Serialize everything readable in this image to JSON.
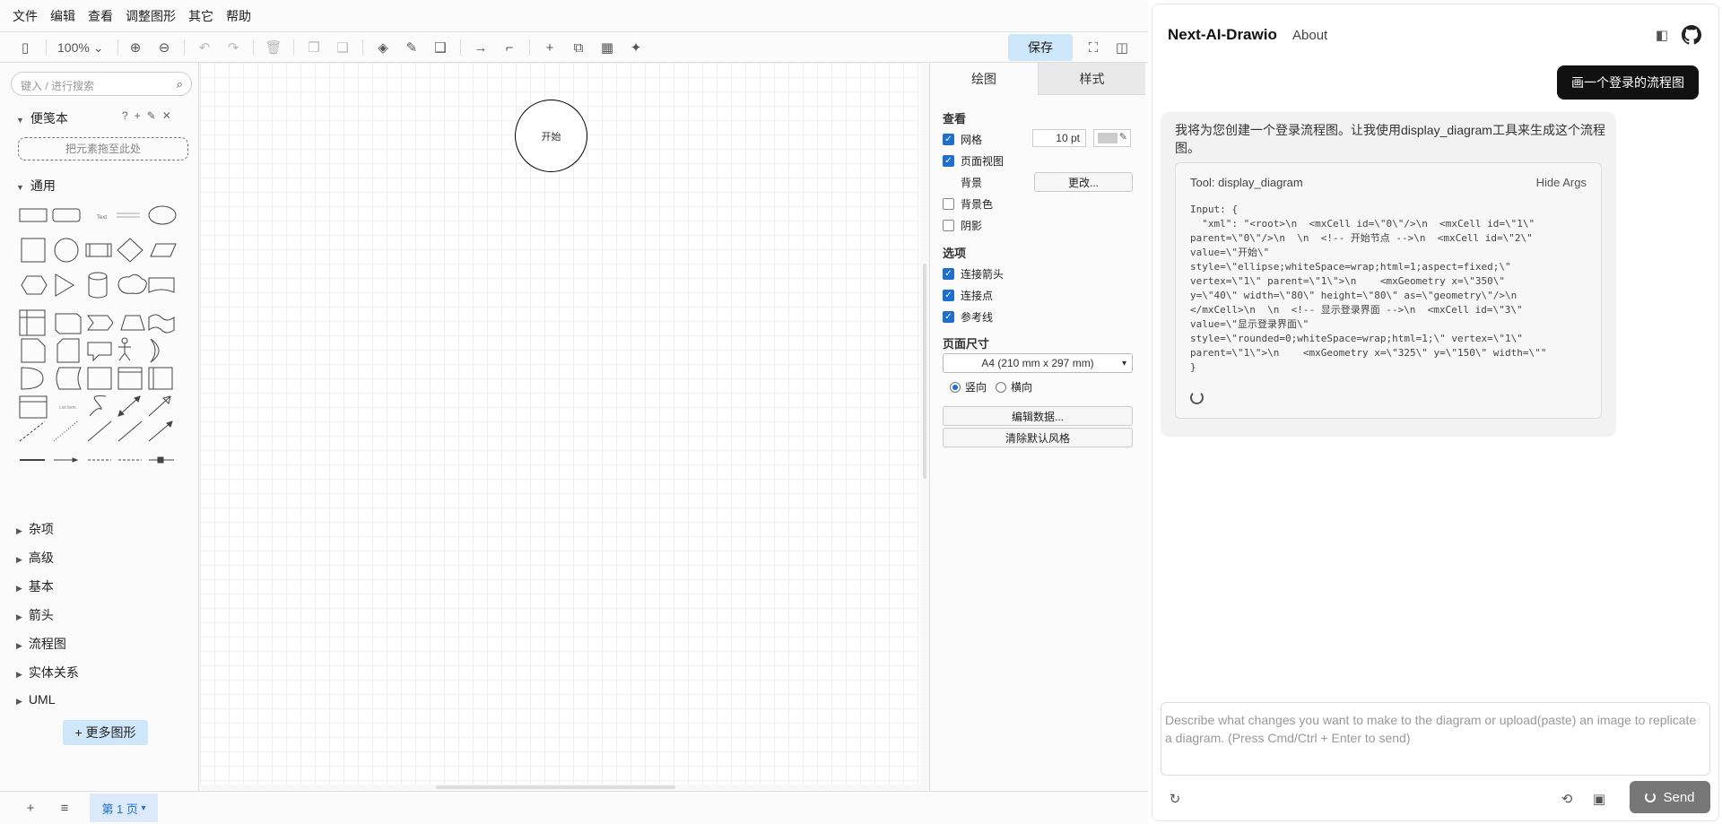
{
  "menu": [
    "文件",
    "编辑",
    "查看",
    "调整图形",
    "其它",
    "帮助"
  ],
  "toolbar": {
    "zoom": "100%",
    "save_label": "保存"
  },
  "sidebar": {
    "search_placeholder": "键入 / 进行搜索",
    "scratchpad_label": "便笺本",
    "scratchpad_drop": "把元素拖至此处",
    "general_label": "通用",
    "categories": [
      "杂项",
      "高级",
      "基本",
      "箭头",
      "流程图",
      "实体关系",
      "UML"
    ],
    "more_shapes": "+ 更多图形"
  },
  "canvas": {
    "start_node_label": "开始"
  },
  "format_panel": {
    "tabs": [
      "绘图",
      "样式"
    ],
    "view_title": "查看",
    "grid_label": "网格",
    "grid_size": "10 pt",
    "page_view_label": "页面视图",
    "background_label": "背景",
    "change_btn": "更改...",
    "background_color_label": "背景色",
    "shadow_label": "阴影",
    "options_title": "选项",
    "connection_arrows_label": "连接箭头",
    "connection_points_label": "连接点",
    "guides_label": "参考线",
    "page_size_title": "页面尺寸",
    "page_size_value": "A4 (210 mm x 297 mm)",
    "portrait_label": "竖向",
    "landscape_label": "横向",
    "edit_data_btn": "编辑数据...",
    "clear_style_btn": "清除默认风格",
    "checks": {
      "grid": true,
      "page_view": true,
      "background_color": false,
      "shadow": false,
      "connection_arrows": true,
      "connection_points": true,
      "guides": true
    }
  },
  "bottom": {
    "page_tab": "第 1 页"
  },
  "chat": {
    "title": "Next-AI-Drawio",
    "about": "About",
    "user_message": "画一个登录的流程图",
    "bot_text": "我将为您创建一个登录流程图。让我使用display_diagram工具来生成这个流程图。",
    "tool_name": "Tool: display_diagram",
    "hide_args": "Hide Args",
    "tool_code": "Input: {\n  \"xml\": \"<root>\\n  <mxCell id=\\\"0\\\"/>\\n  <mxCell id=\\\"1\\\"\nparent=\\\"0\\\"/>\\n  \\n  <!-- 开始节点 -->\\n  <mxCell id=\\\"2\\\"\nvalue=\\\"开始\\\"\nstyle=\\\"ellipse;whiteSpace=wrap;html=1;aspect=fixed;\\\"\nvertex=\\\"1\\\" parent=\\\"1\\\">\\n    <mxGeometry x=\\\"350\\\"\ny=\\\"40\\\" width=\\\"80\\\" height=\\\"80\\\" as=\\\"geometry\\\"/>\\n\n</mxCell>\\n  \\n  <!-- 显示登录界面 -->\\n  <mxCell id=\\\"3\\\"\nvalue=\\\"显示登录界面\\\"\nstyle=\\\"rounded=0;whiteSpace=wrap;html=1;\\\" vertex=\\\"1\\\"\nparent=\\\"1\\\">\\n    <mxGeometry x=\\\"325\\\" y=\\\"150\\\" width=\\\"\"\n}",
    "input_placeholder": "Describe what changes you want to make to the diagram or upload(paste) an image to replicate a diagram. (Press Cmd/Ctrl + Enter to send)",
    "send_label": "Send"
  }
}
